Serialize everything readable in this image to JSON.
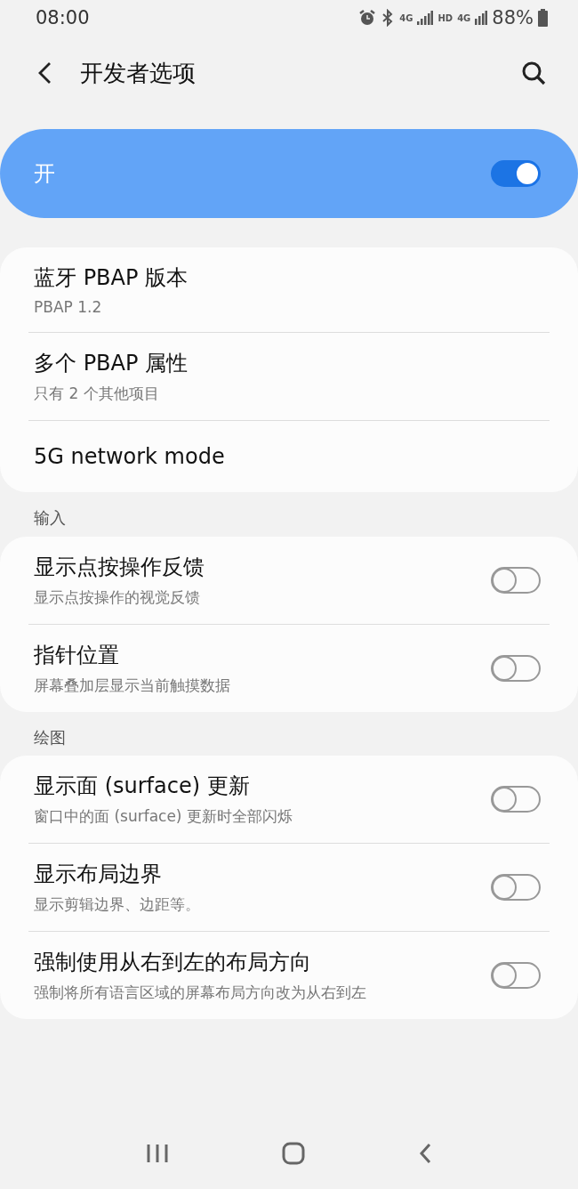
{
  "status_bar": {
    "time": "08:00",
    "network_labels": [
      "4G",
      "HD",
      "4G"
    ],
    "battery": "88%"
  },
  "header": {
    "title": "开发者选项"
  },
  "master_switch": {
    "label": "开",
    "on": true
  },
  "sections": [
    {
      "items": [
        {
          "kind": "info",
          "title": "蓝牙 PBAP 版本",
          "subtitle": "PBAP 1.2"
        },
        {
          "kind": "info",
          "title": "多个 PBAP 属性",
          "subtitle": "只有 2 个其他项目"
        },
        {
          "kind": "info",
          "title": "5G network mode"
        }
      ]
    },
    {
      "heading": "输入",
      "items": [
        {
          "kind": "toggle",
          "title": "显示点按操作反馈",
          "subtitle": "显示点按操作的视觉反馈",
          "on": false
        },
        {
          "kind": "toggle",
          "title": "指针位置",
          "subtitle": "屏幕叠加层显示当前触摸数据",
          "on": false
        }
      ]
    },
    {
      "heading": "绘图",
      "items": [
        {
          "kind": "toggle",
          "title": "显示面 (surface) 更新",
          "subtitle": "窗口中的面 (surface) 更新时全部闪烁",
          "on": false
        },
        {
          "kind": "toggle",
          "title": "显示布局边界",
          "subtitle": "显示剪辑边界、边距等。",
          "on": false
        },
        {
          "kind": "toggle",
          "title": "强制使用从右到左的布局方向",
          "subtitle": "强制将所有语言区域的屏幕布局方向改为从右到左",
          "on": false
        }
      ]
    }
  ]
}
